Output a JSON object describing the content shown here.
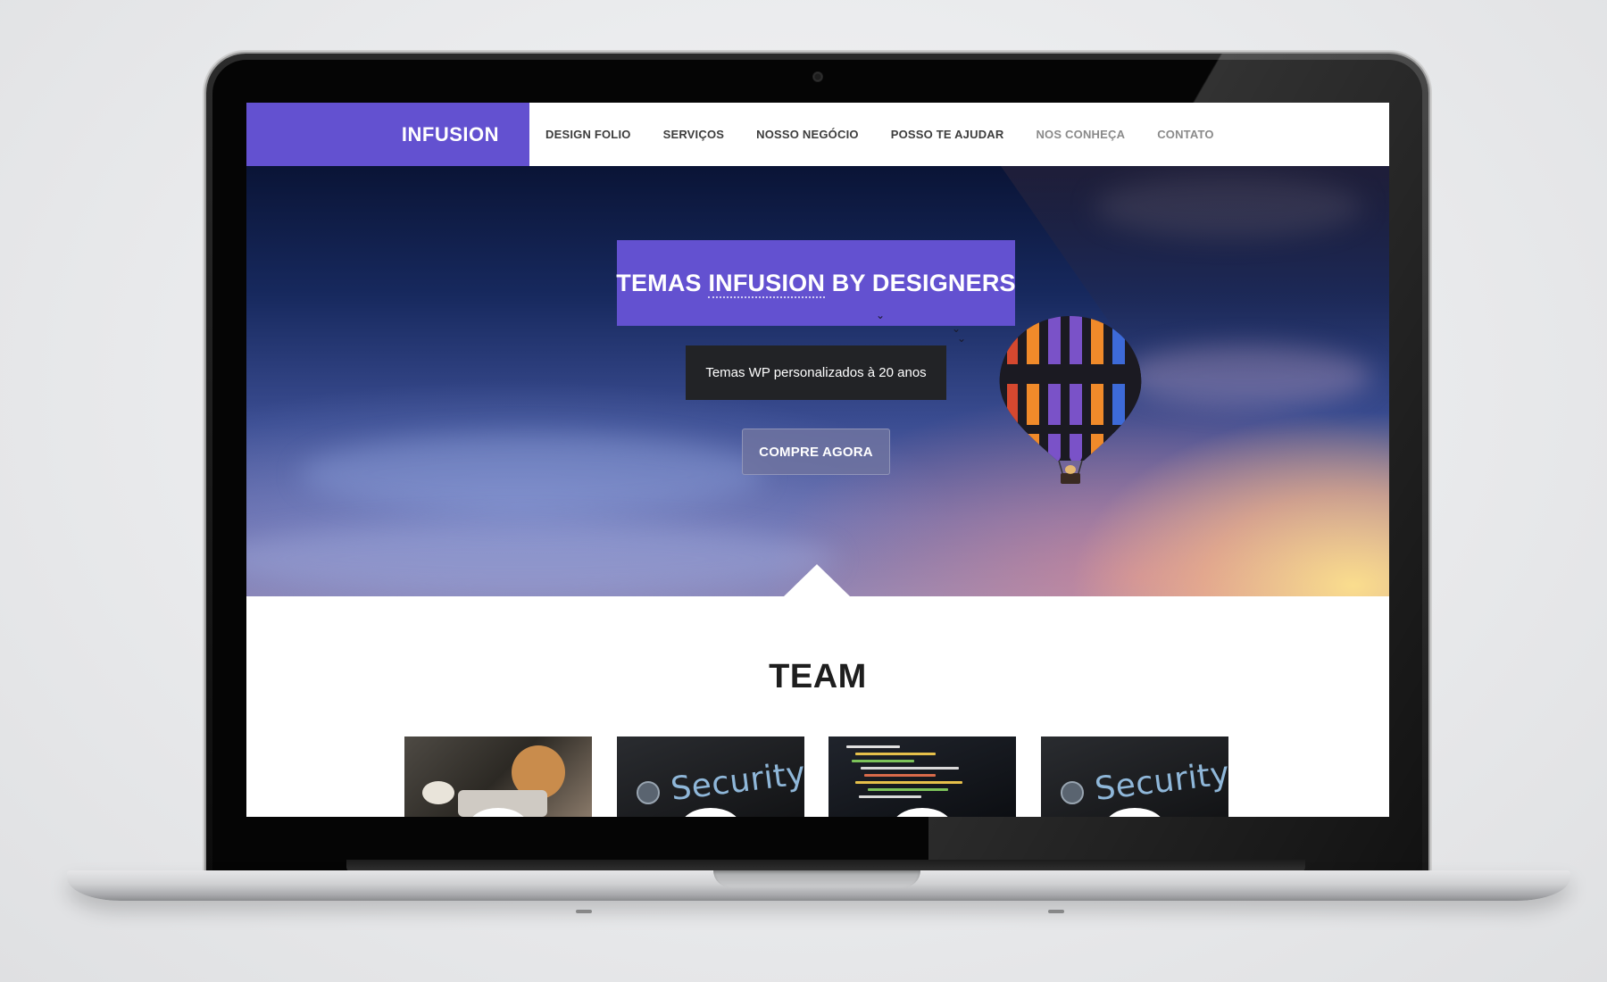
{
  "site": {
    "logo": "INFUSION",
    "nav": [
      {
        "label": "DESIGN FOLIO"
      },
      {
        "label": "SERVIÇOS"
      },
      {
        "label": "NOSSO NEGÓCIO"
      },
      {
        "label": "POSSO TE AJUDAR"
      },
      {
        "label": "NOS CONHEÇA"
      },
      {
        "label": "CONTATO"
      }
    ]
  },
  "hero": {
    "title_pre": "TEMAS ",
    "title_link": "INFUSION",
    "title_post": " BY DESIGNERS",
    "subtitle": "Temas WP personalizados à 20 anos",
    "cta_label": "COMPRE AGORA"
  },
  "team": {
    "title": "TEAM",
    "cards": [
      {
        "caption": ""
      },
      {
        "caption": "Security"
      },
      {
        "caption": ""
      },
      {
        "caption": "Security"
      }
    ]
  },
  "colors": {
    "brand_purple": "#6351d0",
    "dark_box": "#222326"
  }
}
